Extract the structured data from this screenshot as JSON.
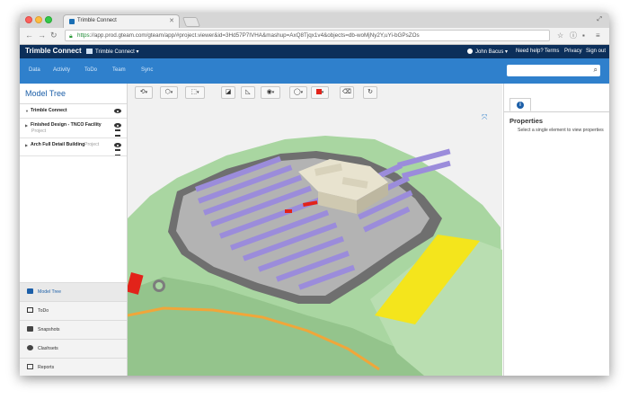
{
  "browser": {
    "tab_title": "Trimble Connect",
    "tab_close": "✕",
    "url_scheme": "https",
    "url_rest": "://app.prod.gteam.com/gteam/app/#project.viewer&id=3Hd57P7IVHA&mashup=AxQ8Tjqx1v4&objects=db-woMjNy2Y,uYi-bGPsZOs"
  },
  "header": {
    "logo": "Trimble Connect",
    "project": "Trimble Connect ▾",
    "user": "John Bacus ▾",
    "links": [
      "Need help?",
      "Terms",
      "Privacy",
      "Sign out"
    ]
  },
  "subnav": {
    "items": [
      "Data",
      "Activity",
      "ToDo",
      "Team",
      "Sync"
    ],
    "search_placeholder": ""
  },
  "left_panel": {
    "title": "Model Tree",
    "tree": [
      {
        "label": "Trimble Connect",
        "sub": ""
      },
      {
        "label": "Finished Design - TNCO Facility",
        "sub": "Project"
      },
      {
        "label": "Arch Full Detail Building",
        "sub": "Project"
      }
    ],
    "bottom_items": [
      "Model Tree",
      "ToDo",
      "Snapshots",
      "Clashsets",
      "Reports"
    ]
  },
  "right_panel": {
    "title": "Properties",
    "text": "Select a single element to view properties"
  },
  "colors": {
    "appbar": "#0c2f5a",
    "subnav": "#2f80cc",
    "accent": "#1c5fa8",
    "parking": "#9b8cdb",
    "terrain": "#a9d6a1",
    "road": "#6f6f6f",
    "yellow": "#f4e51c",
    "orange": "#f0a63a"
  }
}
